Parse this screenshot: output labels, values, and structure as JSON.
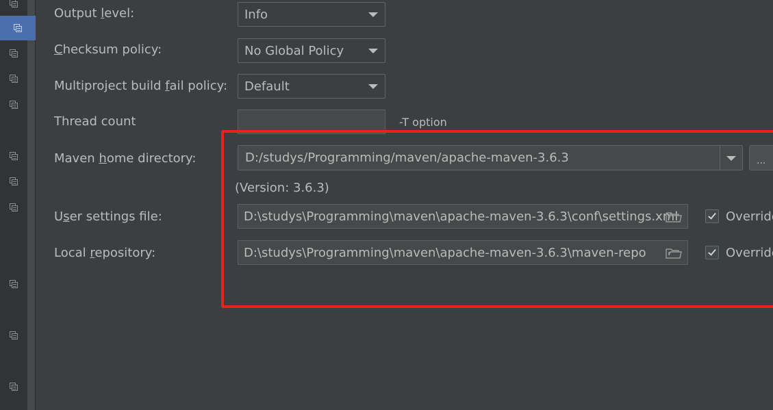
{
  "sidebar": {
    "icons": [
      "copy-icon",
      "copy-icon",
      "copy-icon",
      "copy-icon",
      "copy-icon",
      "copy-icon",
      "copy-icon",
      "copy-icon",
      "copy-icon",
      "copy-icon",
      "copy-icon"
    ]
  },
  "settings": {
    "output_level": {
      "label": "Output level:",
      "mnemonic": "l",
      "value": "Info"
    },
    "checksum_policy": {
      "label": "Checksum policy:",
      "mnemonic": "C",
      "value": "No Global Policy"
    },
    "fail_policy": {
      "label": "Multiproject build fail policy:",
      "mnemonic": "f",
      "value": "Default"
    },
    "thread_count": {
      "label": "Thread count",
      "value": "",
      "hint": "-T option"
    },
    "maven_home": {
      "label": "Maven home directory:",
      "mnemonic": "h",
      "value": "D:/studys/Programming/maven/apache-maven-3.6.3",
      "browse_label": "...",
      "version": "(Version: 3.6.3)"
    },
    "user_settings": {
      "label": "User settings file:",
      "mnemonic": "s",
      "value": "D:\\studys\\Programming\\maven\\apache-maven-3.6.3\\conf\\settings.xml",
      "override_label": "Override",
      "override_checked": true
    },
    "local_repo": {
      "label": "Local repository:",
      "mnemonic": "r",
      "value": "D:\\studys\\Programming\\maven\\apache-maven-3.6.3\\maven-repo",
      "override_label": "Override",
      "override_checked": true
    }
  },
  "colors": {
    "background": "#3c3f41",
    "text": "#bbbbbb",
    "highlight": "#e8231f",
    "active_sidebar": "#4b6eaf"
  }
}
